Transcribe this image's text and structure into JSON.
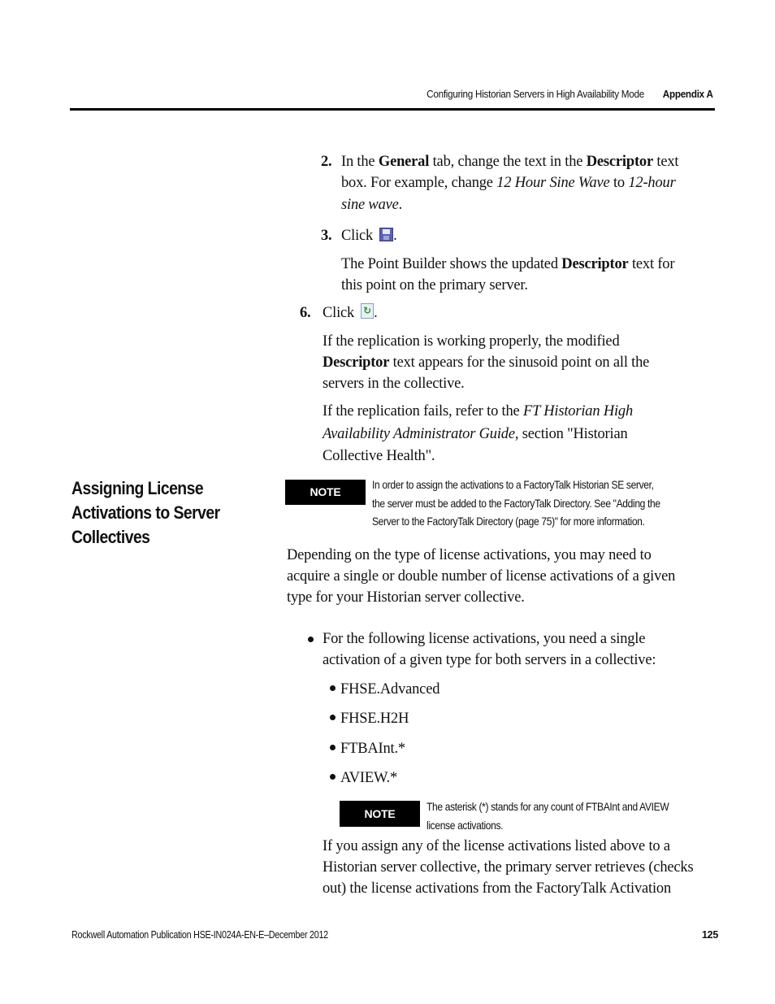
{
  "header": {
    "chapter_title": "Configuring Historian Servers in High Availability Mode",
    "appendix_label": "Appendix A"
  },
  "steps": {
    "step2": {
      "number": "2.",
      "line1_prefix": "In the ",
      "line1_bold1": "General",
      "line1_mid": " tab, change the text in the ",
      "line1_bold2": "Descriptor",
      "line1_suffix": " text",
      "line2_prefix": "box. For example, change ",
      "line2_italic1": "12 Hour Sine Wave",
      "line2_mid": " to ",
      "line2_italic2": "12-hour",
      "line3_italic": "sine wave",
      "line3_suffix": "."
    },
    "step3": {
      "number": "3.",
      "text": "Click",
      "icon": "save-floppy-icon",
      "suffix": ".",
      "result_prefix": "The Point Builder shows the updated ",
      "result_bold": "Descriptor",
      "result_suffix1": " text for",
      "result_line2": "this point on the primary server."
    },
    "step6": {
      "number": "6.",
      "text": "Click",
      "icon": "refresh-icon",
      "suffix": ".",
      "para1_line1": "If the replication is working properly, the modified",
      "para1_bold": "Descriptor",
      "para1_line2_suffix": " text appears for the sinusoid point on all the",
      "para1_line3": "servers in the collective.",
      "para2_line1_prefix": "If the replication fails, refer to the ",
      "para2_line1_italic": "FT Historian High",
      "para2_line2_italic": "Availability Administrator Guide",
      "para2_line2_suffix": ", section \"Historian",
      "para2_line3": "Collective Health\"."
    }
  },
  "section": {
    "heading_lines": [
      "Assigning License",
      "Activations to Server",
      "Collectives"
    ],
    "note1": {
      "badge": "NOTE",
      "lines": [
        "In order to assign the activations to a FactoryTalk Historian SE server,",
        "the server must be added to the FactoryTalk Directory. See \"Adding the",
        "Server to the FactoryTalk Directory (page 75)\" for more information."
      ]
    },
    "intro_lines": [
      "Depending on the type of license activations, you may need to",
      "acquire a single or double number of license activations of a given",
      "type for your Historian server collective."
    ],
    "bullet1_lines": [
      "For the following license activations, you need a single",
      "activation of a given type for both servers in a collective:"
    ],
    "license_types": [
      "FHSE.Advanced",
      "FHSE.H2H",
      "FTBAInt.*",
      "AVIEW.*"
    ],
    "note2": {
      "badge": "NOTE",
      "lines": [
        "The asterisk (*) stands for any count of FTBAInt and AVIEW",
        "license activations."
      ]
    },
    "closing_lines": [
      "If you assign any of the license activations listed above to a",
      "Historian server collective, the primary server retrieves (checks",
      "out) the license activations from the FactoryTalk Activation"
    ]
  },
  "footer": {
    "publication": "Rockwell Automation Publication HSE-IN024A-EN-E–December 2012",
    "page_number": "125"
  }
}
